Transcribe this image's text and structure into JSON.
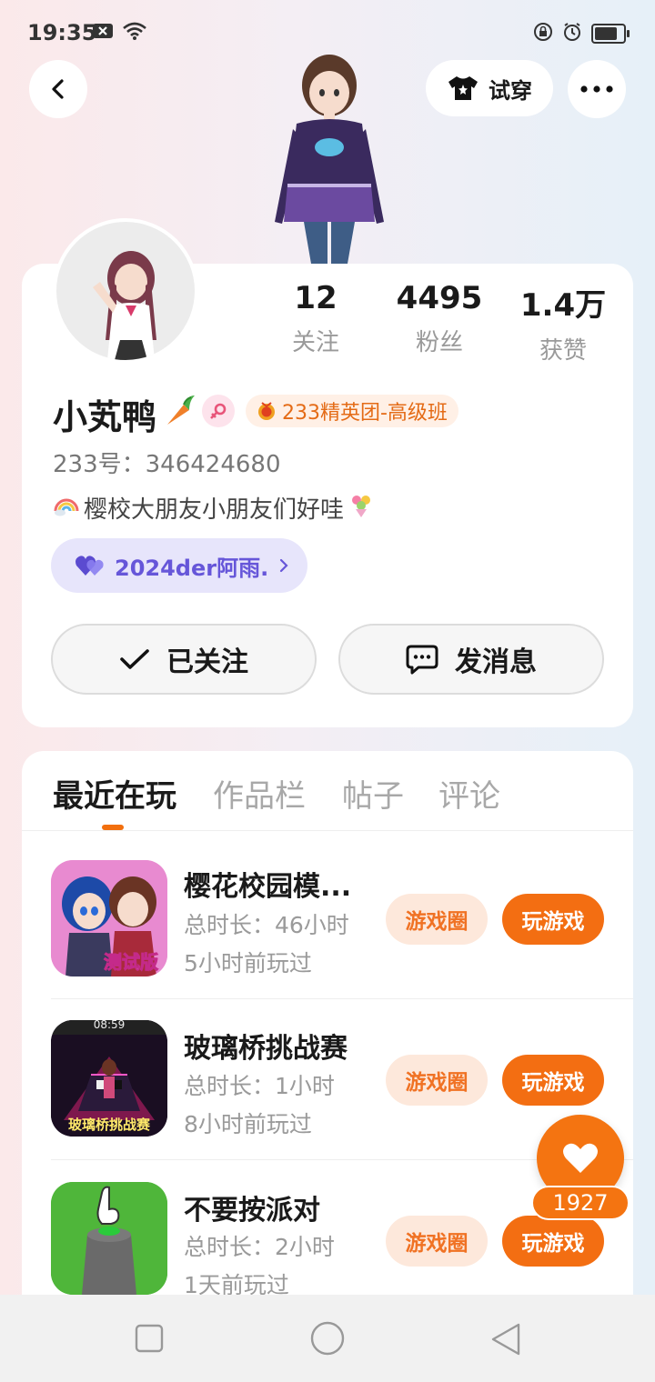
{
  "status_bar": {
    "time": "19:35"
  },
  "header": {
    "tryon_label": "试穿"
  },
  "stats": [
    {
      "value": "12",
      "label": "关注"
    },
    {
      "value": "4495",
      "label": "粉丝"
    },
    {
      "value": "1.4万",
      "label": "获赞"
    }
  ],
  "profile": {
    "name": "小芄鸭",
    "rank_badge": "233精英团-高级班",
    "id_line": "233号：346424680",
    "bio": "樱校大朋友小朋友们好哇",
    "partner": "2024der阿雨."
  },
  "actions": {
    "follow_label": "已关注",
    "message_label": "发消息"
  },
  "tabs": [
    {
      "label": "最近在玩",
      "active": true
    },
    {
      "label": "作品栏",
      "active": false
    },
    {
      "label": "帖子",
      "active": false
    },
    {
      "label": "评论",
      "active": false
    }
  ],
  "games": [
    {
      "title": "樱花校园模...",
      "duration": "总时长：46小时",
      "last_played": "5小时前玩过",
      "icon_caption": "测试版"
    },
    {
      "title": "玻璃桥挑战赛",
      "duration": "总时长：1小时",
      "last_played": "8小时前玩过",
      "icon_caption": "玻璃桥挑战赛",
      "icon_time": "08:59"
    },
    {
      "title": "不要按派对",
      "duration": "总时长：2小时",
      "last_played": "1天前玩过"
    }
  ],
  "game_buttons": {
    "circle_label": "游戏圈",
    "play_label": "玩游戏"
  },
  "like": {
    "count": "1927"
  },
  "colors": {
    "accent": "#f36e12",
    "partner": "#6656d9"
  }
}
